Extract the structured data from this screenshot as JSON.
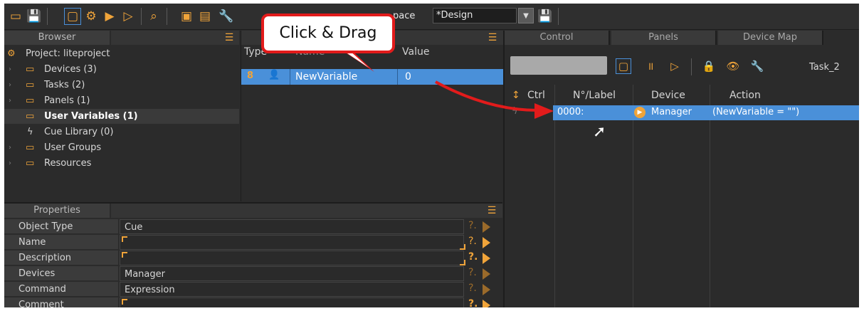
{
  "toolbar": {
    "workspace_label": "pace",
    "workspace_value": "*Design"
  },
  "browser": {
    "title": "Browser",
    "items": [
      {
        "label": "Project: liteproject"
      },
      {
        "label": "Devices (3)"
      },
      {
        "label": "Tasks (2)"
      },
      {
        "label": "Panels (1)"
      },
      {
        "label": "User Variables (1)"
      },
      {
        "label": "Cue Library (0)"
      },
      {
        "label": "User Groups"
      },
      {
        "label": "Resources"
      }
    ]
  },
  "variables": {
    "columns": {
      "type": "Type",
      "name": "Name",
      "value": "Value"
    },
    "rows": [
      {
        "type": "8",
        "name": "NewVariable",
        "value": "0"
      }
    ]
  },
  "properties": {
    "title": "Properties",
    "rows": [
      {
        "key": "Object Type",
        "value": "Cue"
      },
      {
        "key": "Name",
        "value": ""
      },
      {
        "key": "Description",
        "value": ""
      },
      {
        "key": "Devices",
        "value": "Manager"
      },
      {
        "key": "Command",
        "value": "Expression"
      },
      {
        "key": "Comment",
        "value": ""
      }
    ]
  },
  "right_panel": {
    "tabs": [
      "Control",
      "Panels",
      "Device Map"
    ],
    "task_label": "Task_2",
    "columns": {
      "ctrl": "Ctrl",
      "label": "N°/Label",
      "device": "Device",
      "action": "Action"
    },
    "rows": [
      {
        "label": "0000:",
        "device": "Manager",
        "action": "(NewVariable = \"\")"
      }
    ]
  },
  "callout": {
    "text": "Click & Drag"
  },
  "colors": {
    "accent": "#f0a43a",
    "selection": "#4a90d9",
    "annotation": "#e21b1b"
  }
}
